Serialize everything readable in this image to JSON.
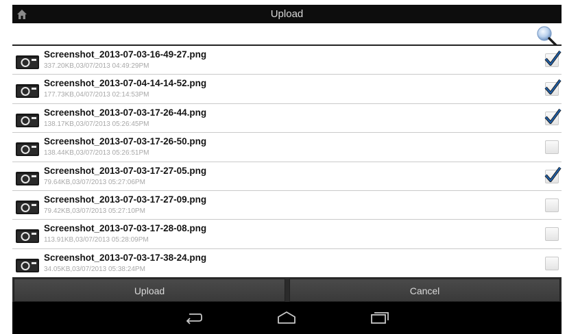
{
  "header": {
    "title": "Upload",
    "home_icon": "home-icon"
  },
  "search": {
    "value": "",
    "placeholder": "",
    "icon": "search-magnifier-icon"
  },
  "files": [
    {
      "name": "Screenshot_2013-07-03-16-49-27.png",
      "meta": "337.20KB,03/07/2013 04:49:29PM",
      "checked": true
    },
    {
      "name": "Screenshot_2013-07-04-14-14-52.png",
      "meta": "177.73KB,04/07/2013 02:14:53PM",
      "checked": true
    },
    {
      "name": "Screenshot_2013-07-03-17-26-44.png",
      "meta": "138.17KB,03/07/2013 05:26:45PM",
      "checked": true
    },
    {
      "name": "Screenshot_2013-07-03-17-26-50.png",
      "meta": "138.44KB,03/07/2013 05:26:51PM",
      "checked": false
    },
    {
      "name": "Screenshot_2013-07-03-17-27-05.png",
      "meta": "79.64KB,03/07/2013 05:27:06PM",
      "checked": true
    },
    {
      "name": "Screenshot_2013-07-03-17-27-09.png",
      "meta": "79.42KB,03/07/2013 05:27:10PM",
      "checked": false
    },
    {
      "name": "Screenshot_2013-07-03-17-28-08.png",
      "meta": "113.91KB,03/07/2013 05:28:09PM",
      "checked": false
    },
    {
      "name": "Screenshot_2013-07-03-17-38-24.png",
      "meta": "34.05KB,03/07/2013 05:38:24PM",
      "checked": false
    }
  ],
  "buttons": {
    "upload_label": "Upload",
    "cancel_label": "Cancel"
  },
  "navbar": {
    "back_icon": "back-icon",
    "home_icon": "home-icon",
    "recent_icon": "recent-apps-icon"
  },
  "colors": {
    "titlebar_bg": "#0d0d0d",
    "check_blue": "#1f5fa8",
    "button_bg": "#424242",
    "navbar_bg": "#000000"
  }
}
